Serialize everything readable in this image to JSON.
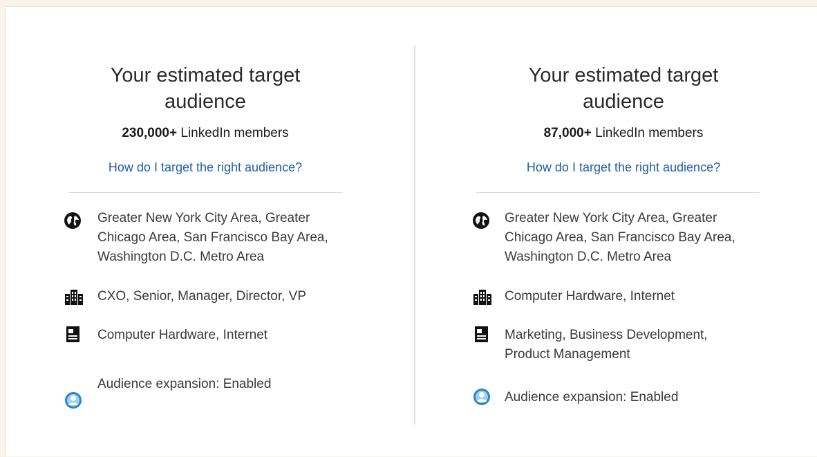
{
  "left_panel": {
    "title": "Your estimated target audience",
    "member_count": "230,000+",
    "member_suffix": " LinkedIn members",
    "help_link": "How do I target the right audience?",
    "criteria": {
      "locations": [
        "Greater New York City Area, Greater",
        "Chicago Area, San Francisco Bay Area,",
        "Washington D.C. Metro Area"
      ],
      "job_seniority": "CXO, Senior, Manager, Director, VP",
      "industries": "Computer Hardware, Internet",
      "audience_expansion": "Audience expansion: Enabled"
    }
  },
  "right_panel": {
    "title": "Your estimated target audience",
    "member_count": "87,000+",
    "member_suffix": " LinkedIn members",
    "help_link": "How do I target the right audience?",
    "criteria": {
      "locations": [
        "Greater New York City Area, Greater",
        "Chicago Area, San Francisco Bay Area,",
        "Washington D.C. Metro Area"
      ],
      "industries": "Computer Hardware, Internet",
      "job_functions": [
        "Marketing, Business Development,",
        "Product Management"
      ],
      "audience_expansion": "Audience expansion: Enabled"
    }
  },
  "icons": {
    "location": "globe-icon",
    "seniority": "building-icon",
    "industry": "document-icon",
    "expansion": "person-circle-icon"
  },
  "colors": {
    "link": "#1f5fa6",
    "expansion_icon": "#2a86c8"
  }
}
